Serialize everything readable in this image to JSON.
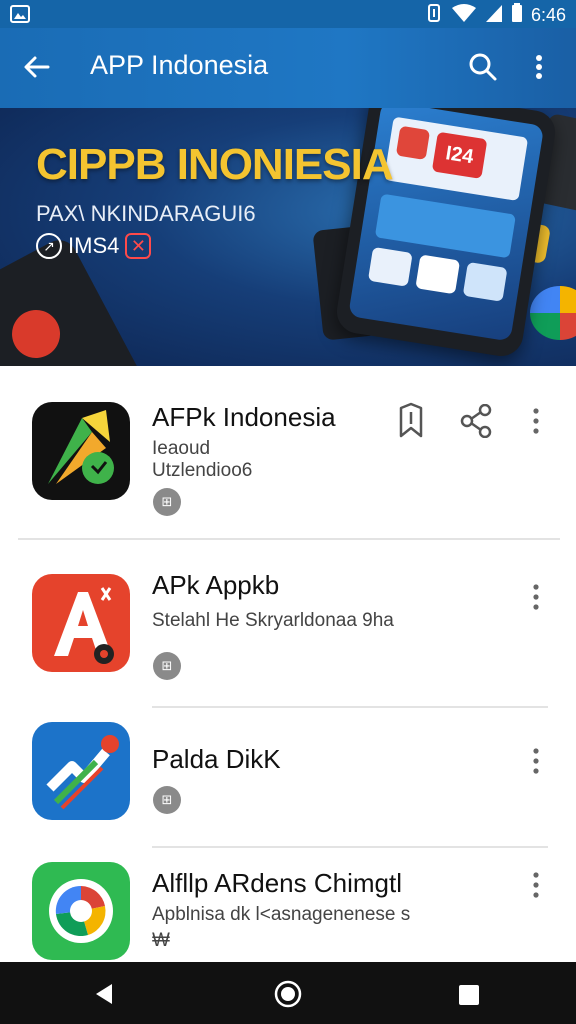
{
  "status_bar": {
    "time": "6:46"
  },
  "app_bar": {
    "title": "APP Indonesia"
  },
  "banner": {
    "headline": "CIPPB INONIESIA",
    "subline": "PAX\\ NKINDARAGUI6",
    "tagline": "IMS4",
    "phone_screen_text": "I24"
  },
  "apps": [
    {
      "name": "AFPk Indonesia",
      "line1": "Ieaoud",
      "line2": "Utzlendioo6",
      "badge": "⊞"
    },
    {
      "name": "APk Appkb",
      "line1": "Stelahl He Skryarldonaa 9ha",
      "badge": "⊞"
    },
    {
      "name": "Palda DikK",
      "badge": "⊞"
    },
    {
      "name": "Alfllp ARdens Chimgtl",
      "line1": "Apblnisa dk l<asnagenenese s",
      "line2": "₩"
    }
  ],
  "colors": {
    "app_bar": "#1f77c4",
    "headline": "#f4c430",
    "icon1_bg": "#111111",
    "icon2_bg": "#e5432c",
    "icon3_bg": "#1c73c9",
    "icon4_bg": "#2fba52"
  }
}
